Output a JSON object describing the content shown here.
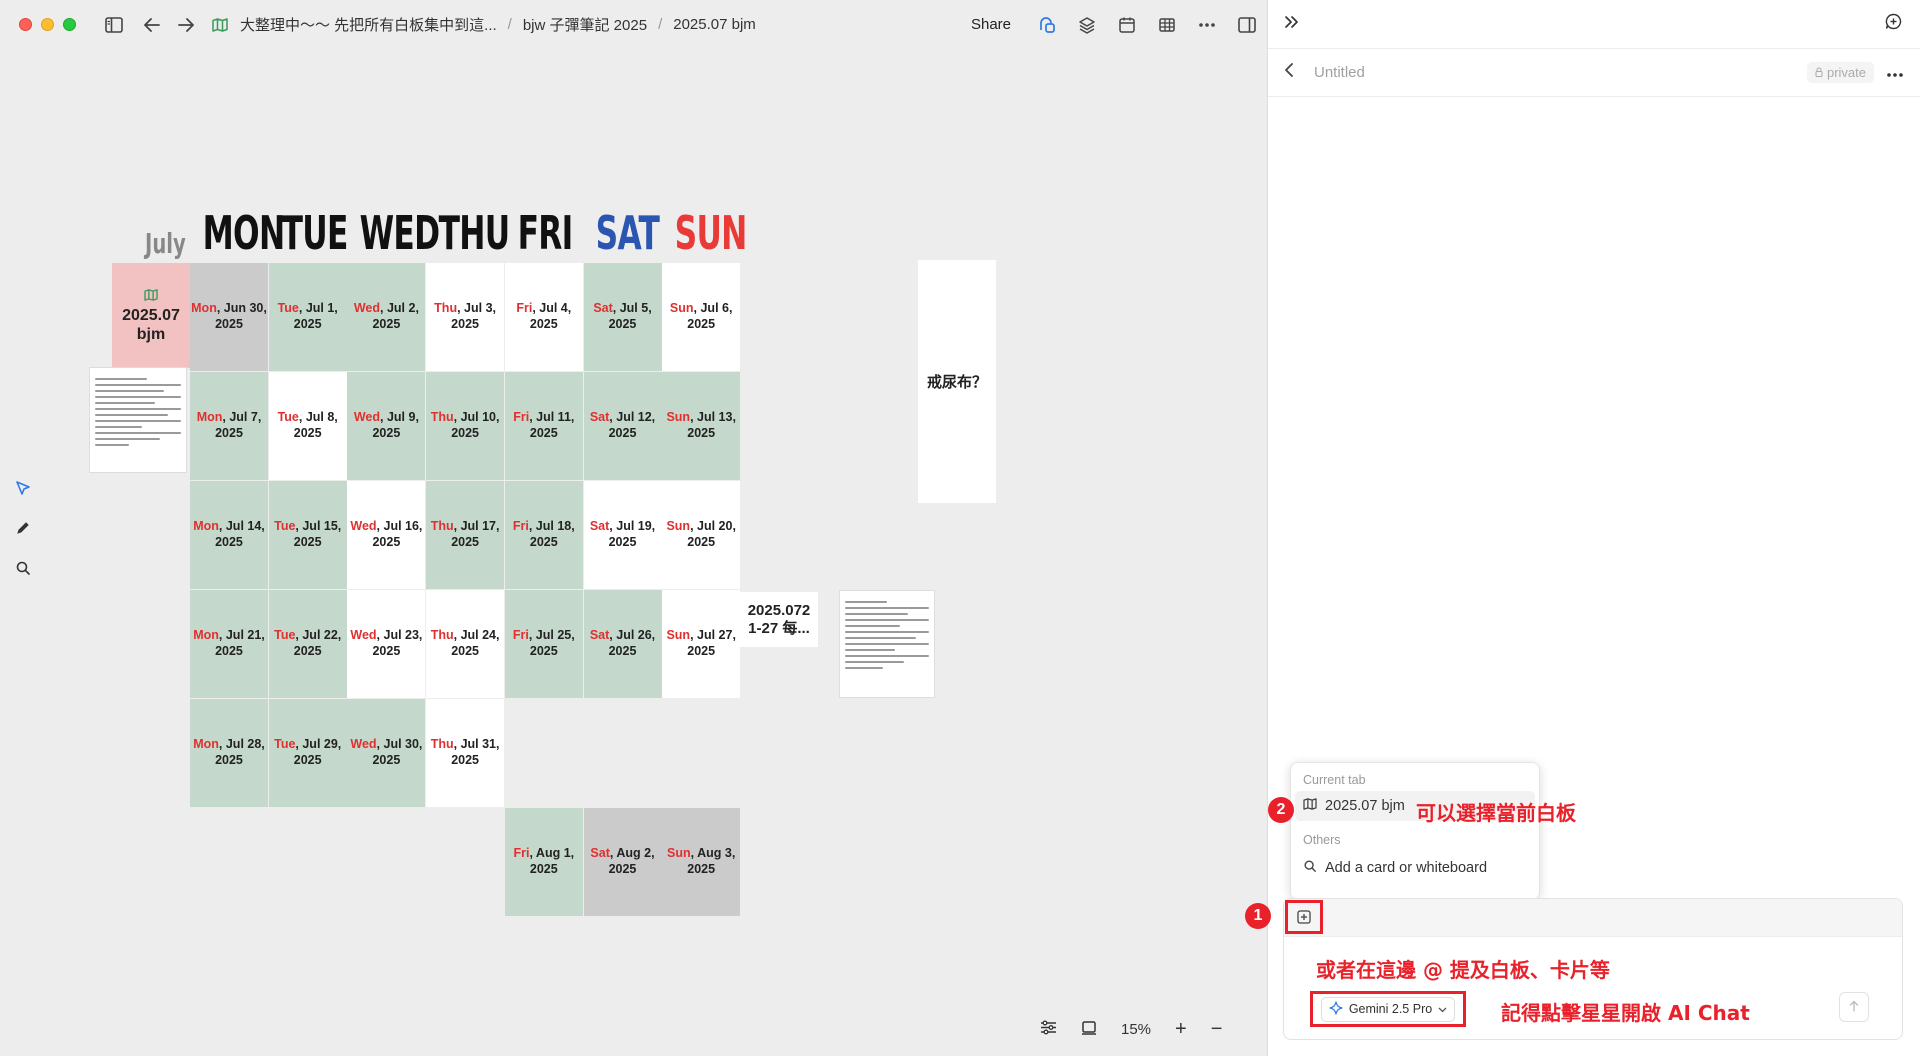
{
  "titlebar": {
    "crumbs": [
      "大整理中～～ 先把所有白板集中到這...",
      "bjw 子彈筆記 2025",
      "2025.07 bjm"
    ],
    "share_label": "Share"
  },
  "calendar": {
    "month": "July",
    "day_names": [
      "MON",
      "TUE",
      "WED",
      "THU",
      "FRI",
      "SAT",
      "SUN"
    ],
    "board_card": {
      "title": "2025.07 bjm"
    },
    "rows": [
      [
        {
          "day": "Mon",
          "rest": ", Jun 30,",
          "year": "2025",
          "color": "gray"
        },
        {
          "day": "Tue",
          "rest": ", Jul 1,",
          "year": "2025",
          "color": "green"
        },
        {
          "day": "Wed",
          "rest": ", Jul 2,",
          "year": "2025",
          "color": "green"
        },
        {
          "day": "Thu",
          "rest": ", Jul 3,",
          "year": "2025",
          "color": "white"
        },
        {
          "day": "Fri",
          "rest": ", Jul 4,",
          "year": "2025",
          "color": "white"
        },
        {
          "day": "Sat",
          "rest": ", Jul 5,",
          "year": "2025",
          "color": "green"
        },
        {
          "day": "Sun",
          "rest": ", Jul 6,",
          "year": "2025",
          "color": "white"
        }
      ],
      [
        {
          "day": "Mon",
          "rest": ", Jul 7,",
          "year": "2025",
          "color": "green"
        },
        {
          "day": "Tue",
          "rest": ", Jul 8,",
          "year": "2025",
          "color": "white"
        },
        {
          "day": "Wed",
          "rest": ", Jul 9,",
          "year": "2025",
          "color": "green"
        },
        {
          "day": "Thu",
          "rest": ", Jul 10,",
          "year": "2025",
          "color": "green"
        },
        {
          "day": "Fri",
          "rest": ", Jul 11,",
          "year": "2025",
          "color": "green"
        },
        {
          "day": "Sat",
          "rest": ", Jul 12,",
          "year": "2025",
          "color": "green"
        },
        {
          "day": "Sun",
          "rest": ", Jul 13,",
          "year": "2025",
          "color": "green"
        }
      ],
      [
        {
          "day": "Mon",
          "rest": ", Jul 14,",
          "year": "2025",
          "color": "green"
        },
        {
          "day": "Tue",
          "rest": ", Jul 15,",
          "year": "2025",
          "color": "green"
        },
        {
          "day": "Wed",
          "rest": ", Jul 16,",
          "year": "2025",
          "color": "white"
        },
        {
          "day": "Thu",
          "rest": ", Jul 17,",
          "year": "2025",
          "color": "green"
        },
        {
          "day": "Fri",
          "rest": ", Jul 18,",
          "year": "2025",
          "color": "green"
        },
        {
          "day": "Sat",
          "rest": ", Jul 19,",
          "year": "2025",
          "color": "white"
        },
        {
          "day": "Sun",
          "rest": ", Jul 20,",
          "year": "2025",
          "color": "white"
        }
      ],
      [
        {
          "day": "Mon",
          "rest": ", Jul 21,",
          "year": "2025",
          "color": "green"
        },
        {
          "day": "Tue",
          "rest": ", Jul 22,",
          "year": "2025",
          "color": "green"
        },
        {
          "day": "Wed",
          "rest": ", Jul 23,",
          "year": "2025",
          "color": "white"
        },
        {
          "day": "Thu",
          "rest": ", Jul 24,",
          "year": "2025",
          "color": "white"
        },
        {
          "day": "Fri",
          "rest": ", Jul 25,",
          "year": "2025",
          "color": "green"
        },
        {
          "day": "Sat",
          "rest": ", Jul 26,",
          "year": "2025",
          "color": "green"
        },
        {
          "day": "Sun",
          "rest": ", Jul 27,",
          "year": "2025",
          "color": "white"
        }
      ],
      [
        {
          "day": "Mon",
          "rest": ", Jul 28,",
          "year": "2025",
          "color": "green"
        },
        {
          "day": "Tue",
          "rest": ", Jul 29,",
          "year": "2025",
          "color": "green"
        },
        {
          "day": "Wed",
          "rest": ", Jul 30,",
          "year": "2025",
          "color": "green"
        },
        {
          "day": "Thu",
          "rest": ", Jul 31,",
          "year": "2025",
          "color": "white"
        },
        null,
        null,
        null
      ],
      [
        null,
        null,
        null,
        null,
        {
          "day": "Fri",
          "rest": ", Aug 1,",
          "year": "2025",
          "color": "green"
        },
        {
          "day": "Sat",
          "rest": ", Aug 2,",
          "year": "2025",
          "color": "gray"
        },
        {
          "day": "Sun",
          "rest": ", Aug 3,",
          "year": "2025",
          "color": "gray"
        }
      ]
    ],
    "notes": {
      "diaper": "戒尿布？",
      "weekly": "2025.072 1-27 每..."
    }
  },
  "canvas_controls": {
    "zoom": "15%",
    "plus": "+",
    "minus": "−"
  },
  "panel": {
    "title": "Untitled",
    "private_label": "private",
    "popup": {
      "current_tab_label": "Current tab",
      "current_tab_item": "2025.07 bjm",
      "others_label": "Others",
      "add_item": "Add a card or whiteboard"
    },
    "model_label": "Gemini 2.5 Pro"
  },
  "annotations": {
    "badge1": "1",
    "badge2": "2",
    "select_board": "可以選擇當前白板",
    "mention": "或者在這邊 @ 提及白板、卡片等",
    "star_hint": "記得點擊星星開啟 AI Chat"
  },
  "colors": {
    "green": "#c4d8cb",
    "white": "#ffffff",
    "gray": "#cbcbcb",
    "pink": "#f2c2c2",
    "highlight_red": "#e8212a",
    "sat_blue": "#2a55b0",
    "sun_red": "#e83a36"
  },
  "icons": [
    "sidebar-toggle-icon",
    "back-arrow-icon",
    "forward-arrow-icon",
    "whiteboard-icon",
    "collaboration-icon",
    "layers-icon",
    "calendar-icon",
    "table-icon",
    "more-icon",
    "split-view-icon",
    "collapse-panel-icon",
    "new-chat-icon",
    "select-tool-icon",
    "pen-tool-icon",
    "search-icon",
    "sliders-icon",
    "frame-icon",
    "lock-icon",
    "sparkle-icon",
    "send-icon"
  ]
}
